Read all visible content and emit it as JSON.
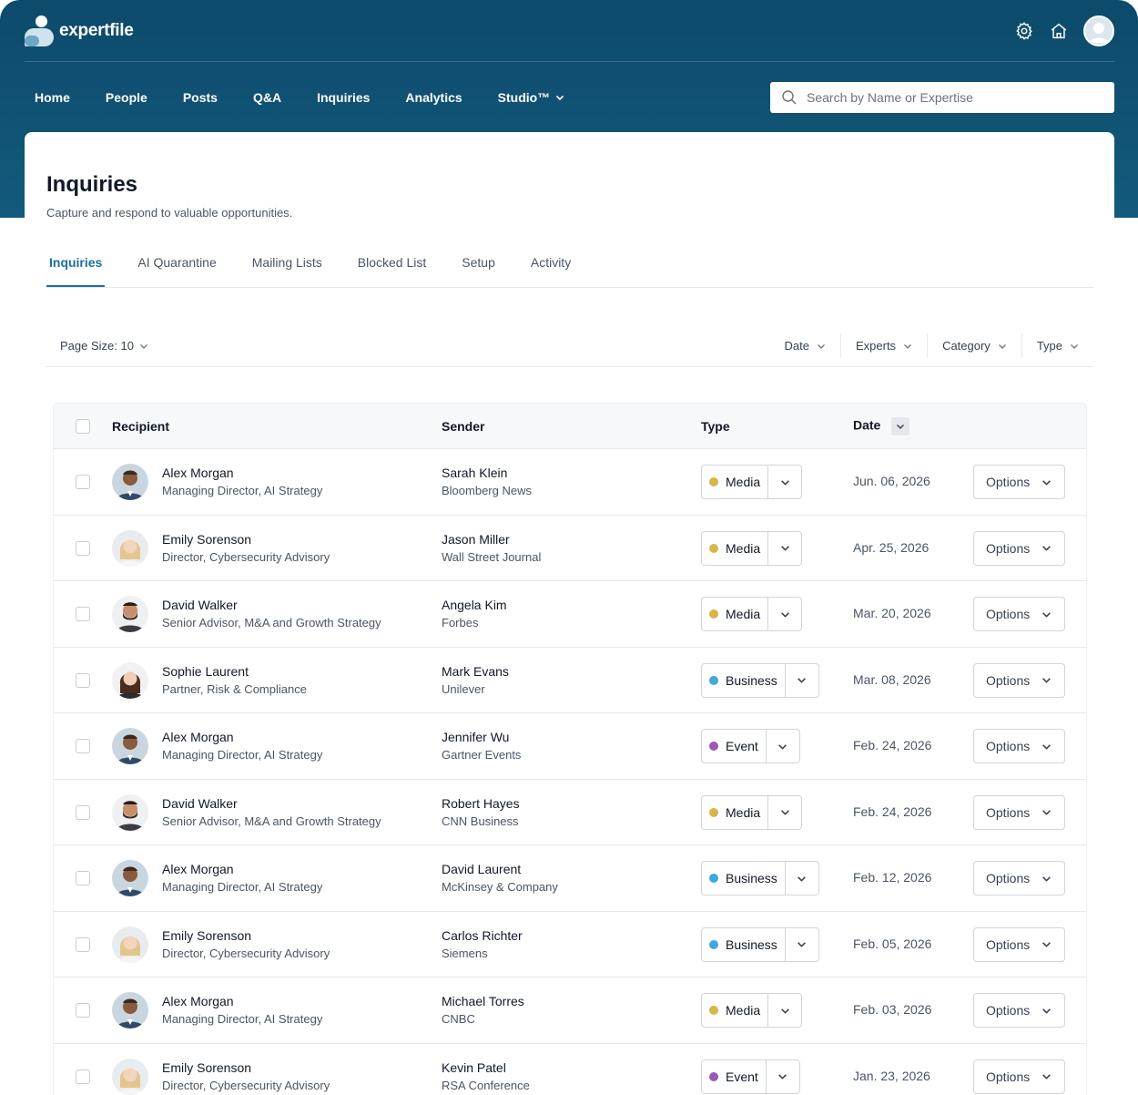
{
  "app": {
    "logo_text": "expertfile"
  },
  "nav": {
    "items": [
      "Home",
      "People",
      "Posts",
      "Q&A",
      "Inquiries",
      "Analytics",
      "Studio™"
    ],
    "search_placeholder": "Search by Name or Expertise"
  },
  "page": {
    "title": "Inquiries",
    "subtitle": "Capture and respond to valuable opportunities."
  },
  "tabs": [
    "Inquiries",
    "AI Quarantine",
    "Mailing Lists",
    "Blocked List",
    "Setup",
    "Activity"
  ],
  "active_tab": "Inquiries",
  "filters": {
    "page_size": "Page Size: 10",
    "date": "Date",
    "experts": "Experts",
    "category": "Category",
    "type": "Type"
  },
  "table": {
    "headers": {
      "recipient": "Recipient",
      "sender": "Sender",
      "type": "Type",
      "date": "Date"
    },
    "options_label": "Options",
    "rows": [
      {
        "recipient_name": "Alex Morgan",
        "recipient_title": "Managing Director, AI Strategy",
        "sender_name": "Sarah Klein",
        "sender_org": "Bloomberg News",
        "type": "Media",
        "date": "Jun. 06, 2026",
        "avatar": "man-dark"
      },
      {
        "recipient_name": "Emily Sorenson",
        "recipient_title": "Director, Cybersecurity Advisory",
        "sender_name": "Jason Miller",
        "sender_org": "Wall Street Journal",
        "type": "Media",
        "date": "Apr. 25, 2026",
        "avatar": "woman-blonde"
      },
      {
        "recipient_name": "David Walker",
        "recipient_title": "Senior Advisor, M&A and Growth Strategy",
        "sender_name": "Angela Kim",
        "sender_org": "Forbes",
        "type": "Media",
        "date": "Mar. 20, 2026",
        "avatar": "man-beard"
      },
      {
        "recipient_name": "Sophie Laurent",
        "recipient_title": "Partner, Risk & Compliance",
        "sender_name": "Mark Evans",
        "sender_org": "Unilever",
        "type": "Business",
        "date": "Mar. 08, 2026",
        "avatar": "woman-brunette"
      },
      {
        "recipient_name": "Alex Morgan",
        "recipient_title": "Managing Director, AI Strategy",
        "sender_name": "Jennifer Wu",
        "sender_org": "Gartner Events",
        "type": "Event",
        "date": "Feb. 24, 2026",
        "avatar": "man-dark"
      },
      {
        "recipient_name": "David Walker",
        "recipient_title": "Senior Advisor, M&A and Growth Strategy",
        "sender_name": "Robert Hayes",
        "sender_org": "CNN Business",
        "type": "Media",
        "date": "Feb. 24, 2026",
        "avatar": "man-beard"
      },
      {
        "recipient_name": "Alex Morgan",
        "recipient_title": "Managing Director, AI Strategy",
        "sender_name": "David Laurent",
        "sender_org": "McKinsey & Company",
        "type": "Business",
        "date": "Feb. 12, 2026",
        "avatar": "man-dark"
      },
      {
        "recipient_name": "Emily Sorenson",
        "recipient_title": "Director, Cybersecurity Advisory",
        "sender_name": "Carlos Richter",
        "sender_org": "Siemens",
        "type": "Business",
        "date": "Feb. 05, 2026",
        "avatar": "woman-blonde"
      },
      {
        "recipient_name": "Alex Morgan",
        "recipient_title": "Managing Director, AI Strategy",
        "sender_name": "Michael Torres",
        "sender_org": "CNBC",
        "type": "Media",
        "date": "Feb. 03, 2026",
        "avatar": "man-dark"
      },
      {
        "recipient_name": "Emily Sorenson",
        "recipient_title": "Director, Cybersecurity Advisory",
        "sender_name": "Kevin Patel",
        "sender_org": "RSA Conference",
        "type": "Event",
        "date": "Jan. 23, 2026",
        "avatar": "woman-blonde"
      }
    ]
  },
  "colors": {
    "header_bg": "#0d4a6b",
    "accent": "#1d6f99",
    "media_dot": "#d9b548",
    "business_dot": "#3fa9dc",
    "event_dot": "#9b59b6"
  }
}
